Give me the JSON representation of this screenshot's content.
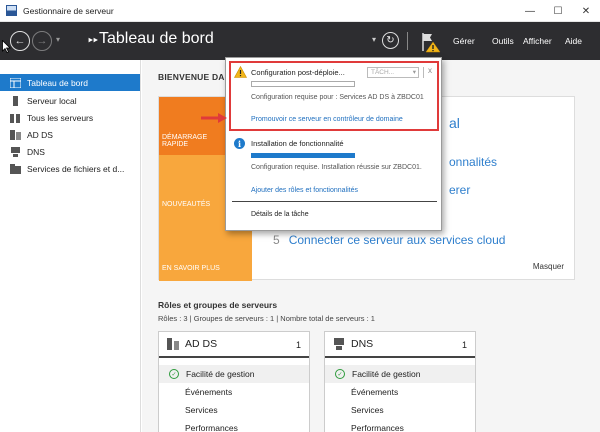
{
  "window": {
    "title": "Gestionnaire de serveur",
    "minimize": "—",
    "maximize": "☐",
    "close": "✕"
  },
  "toolbar": {
    "back": "←",
    "forward": "→",
    "dropdown": "▾",
    "breadcrumb_arrows": "‣‣",
    "page_title": "Tableau de bord",
    "refresh": "↻",
    "menus": [
      "Gérer",
      "Outils",
      "Afficher",
      "Aide"
    ]
  },
  "sidebar": {
    "items": [
      {
        "label": "Tableau de bord",
        "icon": "dashboard-icon",
        "active": true
      },
      {
        "label": "Serveur local",
        "icon": "server-icon"
      },
      {
        "label": "Tous les serveurs",
        "icon": "servers-icon"
      },
      {
        "label": "AD DS",
        "icon": "ad-ds-icon"
      },
      {
        "label": "DNS",
        "icon": "dns-icon"
      },
      {
        "label": "Services de fichiers et d...",
        "icon": "file-services-icon"
      }
    ]
  },
  "main": {
    "welcome_title": "BIENVENUE DA",
    "quick_start": {
      "blocks": [
        "DÉMARRAGE\nRAPIDE",
        "NOUVEAUTÉS",
        "EN SAVOIR PLUS"
      ],
      "links": [
        {
          "num": "",
          "text": "al"
        },
        {
          "num": "",
          "text": "onnalités"
        },
        {
          "num": "",
          "text": "erer"
        },
        {
          "num": "5",
          "text": "Connecter ce serveur aux services cloud"
        }
      ],
      "hide": "Masquer"
    },
    "roles": {
      "title": "Rôles et groupes de serveurs",
      "subtitle": "Rôles : 3   |   Groupes de serveurs : 1   |   Nombre total de serveurs : 1",
      "cards": [
        {
          "name": "AD DS",
          "count": "1",
          "rows": [
            "Facilité de gestion",
            "Événements",
            "Services",
            "Performances"
          ]
        },
        {
          "name": "DNS",
          "count": "1",
          "rows": [
            "Facilité de gestion",
            "Événements",
            "Services",
            "Performances"
          ]
        }
      ]
    }
  },
  "notifications": {
    "item1": {
      "title": "Configuration post-déploie...",
      "task_dropdown": "TÂCH...",
      "close": "x",
      "description": "Configuration requise pour : Services AD DS à ZBDC01",
      "link": "Promouvoir ce serveur en contrôleur de domaine"
    },
    "item2": {
      "title": "Installation de fonctionnalité",
      "progress": 1.0,
      "description": "Configuration requise. Installation réussie sur ZBDC01.",
      "link": "Ajouter des rôles et fonctionnalités"
    },
    "details": "Détails de la tâche"
  },
  "colors": {
    "toolbar_bg": "#2d2d30",
    "accent_blue": "#1e7acb",
    "quickstart_orange": "#f07c1f",
    "quickstart_light_orange": "#f8a73d",
    "highlight_red": "#e03a3a",
    "link_blue": "#1f6fbf",
    "ok_green": "#2e9b3c"
  }
}
